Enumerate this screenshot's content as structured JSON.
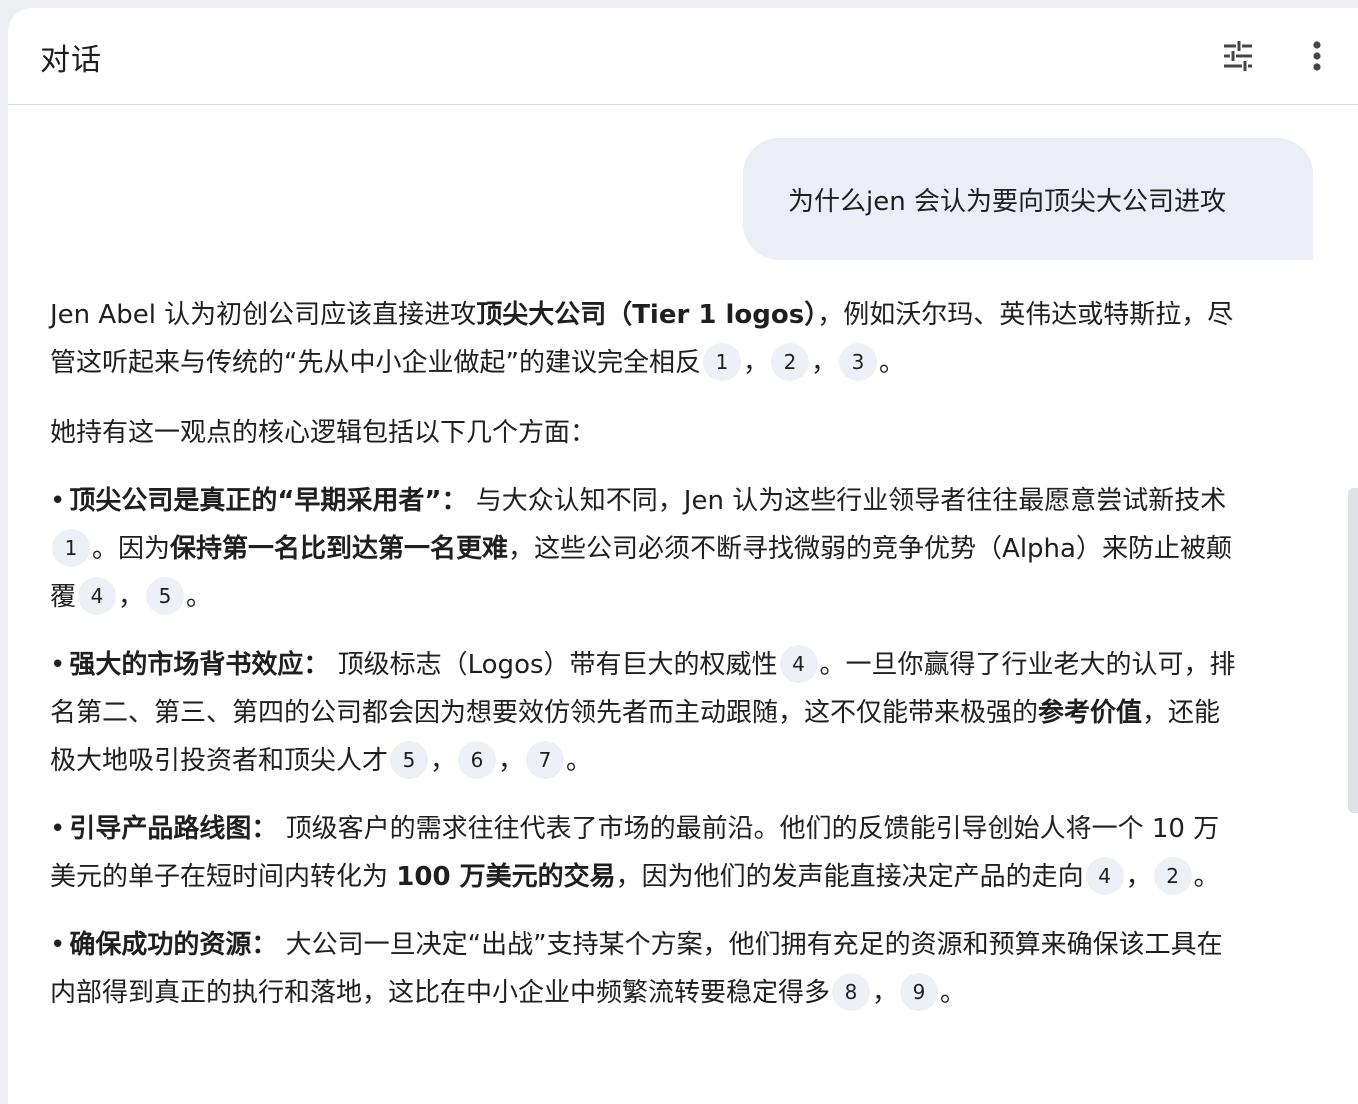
{
  "header": {
    "title": "对话",
    "tune_icon": "tune-icon",
    "more_icon": "more-vert-icon"
  },
  "user_message": "为什么jen 会认为要向顶尖大公司进攻",
  "answer": {
    "p1": {
      "t1": "Jen Abel 认为初创公司应该直接进攻",
      "b1": "顶尖大公司（Tier 1 logos）",
      "t2": "，例如沃尔玛、英伟达或特斯拉，尽管这听起来与传统的“先从中小企业做起”的建议完全相反",
      "cites": [
        "1",
        "2",
        "3"
      ],
      "end": "。"
    },
    "p2": "她持有这一观点的核心逻辑包括以下几个方面：",
    "bullets": [
      {
        "dot": "•",
        "title": "顶尖公司是真正的“早期采用者”：",
        "t1": " 与大众认知不同，Jen 认为这些行业领导者往往最愿意尝试新技术",
        "c1": [
          "1"
        ],
        "t2": "。因为",
        "b2": "保持第一名比到达第一名更难",
        "t3": "，这些公司必须不断寻找微弱的竞争优势（Alpha）来防止被颠覆",
        "c2": [
          "4",
          "5"
        ],
        "end": "。"
      },
      {
        "dot": "•",
        "title": "强大的市场背书效应：",
        "t1": " 顶级标志（Logos）带有巨大的权威性",
        "c1": [
          "4"
        ],
        "t2": "。一旦你赢得了行业老大的认可，排名第二、第三、第四的公司都会因为想要效仿领先者而主动跟随，这不仅能带来极强的",
        "b2": "参考价值",
        "t3": "，还能极大地吸引投资者和顶尖人才",
        "c2": [
          "5",
          "6",
          "7"
        ],
        "end": "。"
      },
      {
        "dot": "•",
        "title": "引导产品路线图：",
        "t1": " 顶级客户的需求往往代表了市场的最前沿。他们的反馈能引导创始人将一个 10 万美元的单子在短时间内转化为 ",
        "c1": [],
        "t2": "",
        "b2": "100 万美元的交易",
        "t3": "，因为他们的发声能直接决定产品的走向",
        "c2": [
          "4",
          "2"
        ],
        "end": "。"
      },
      {
        "dot": "•",
        "title": "确保成功的资源：",
        "t1": " 大公司一旦决定“出战”支持某个方案，他们拥有充足的资源和预算来确保该工具在内部得到真正的执行和落地，这比在中小企业中频繁流转要稳定得多",
        "c1": [
          "8",
          "9"
        ],
        "t2": "",
        "b2": "",
        "t3": "",
        "c2": [],
        "end": "。"
      }
    ]
  }
}
